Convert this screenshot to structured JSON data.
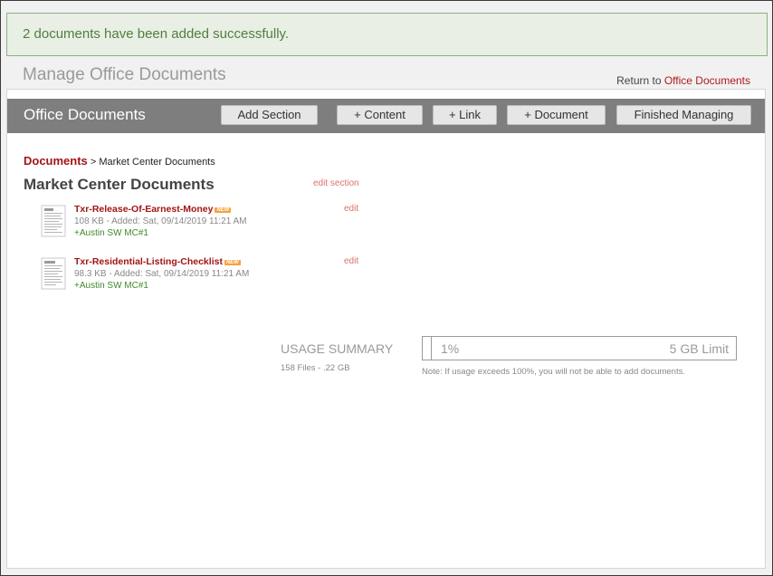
{
  "alert": {
    "message": "2 documents have been added successfully."
  },
  "header": {
    "title": "Manage Office Documents",
    "return_prefix": "Return to",
    "return_link": "Office Documents"
  },
  "toolbar": {
    "title": "Office Documents",
    "buttons": {
      "add_section": "Add Section",
      "add_content": "+ Content",
      "add_link": "+ Link",
      "add_document": "+ Document",
      "finished": "Finished Managing"
    }
  },
  "breadcrumb": {
    "root": "Documents",
    "separator": ">",
    "current": "Market Center Documents"
  },
  "section": {
    "title": "Market Center Documents",
    "edit_label": "edit section",
    "documents": [
      {
        "name": "Txr-Release-Of-Earnest-Money",
        "badge": "NEW",
        "meta": "108 KB - Added: Sat, 09/14/2019 11:21 AM",
        "owner": "+Austin SW MC#1",
        "edit_label": "edit"
      },
      {
        "name": "Txr-Residential-Listing-Checklist",
        "badge": "NEW",
        "meta": "98.3 KB - Added: Sat, 09/14/2019 11:21 AM",
        "owner": "+Austin SW MC#1",
        "edit_label": "edit"
      }
    ]
  },
  "usage": {
    "label": "USAGE SUMMARY",
    "counts": "158 Files - .22 GB",
    "percent_text": "1%",
    "percent_value": 1,
    "limit": "5 GB Limit",
    "note": "Note: If usage exceeds 100%, you will not be able to add documents."
  }
}
